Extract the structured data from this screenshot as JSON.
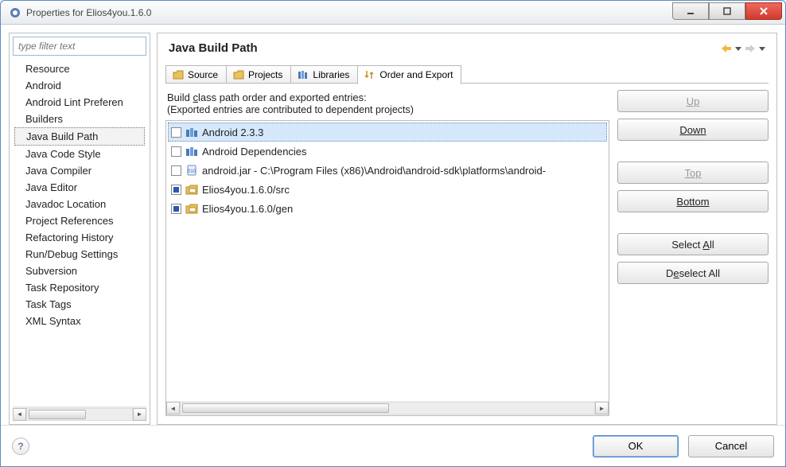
{
  "window": {
    "title": "Properties for Elios4you.1.6.0"
  },
  "sidebar": {
    "filter_placeholder": "type filter text",
    "items": [
      {
        "label": "Resource"
      },
      {
        "label": "Android"
      },
      {
        "label": "Android Lint Preferen"
      },
      {
        "label": "Builders"
      },
      {
        "label": "Java Build Path",
        "selected": true
      },
      {
        "label": "Java Code Style"
      },
      {
        "label": "Java Compiler"
      },
      {
        "label": "Java Editor"
      },
      {
        "label": "Javadoc Location"
      },
      {
        "label": "Project References"
      },
      {
        "label": "Refactoring History"
      },
      {
        "label": "Run/Debug Settings"
      },
      {
        "label": "Subversion"
      },
      {
        "label": "Task Repository"
      },
      {
        "label": "Task Tags"
      },
      {
        "label": "XML Syntax"
      }
    ]
  },
  "main": {
    "heading": "Java Build Path",
    "tabs": [
      {
        "label": "Source",
        "icon": "folder"
      },
      {
        "label": "Projects",
        "icon": "folder"
      },
      {
        "label": "Libraries",
        "icon": "library"
      },
      {
        "label": "Order and Export",
        "icon": "order",
        "active": true
      }
    ],
    "description_line1_pre": "Build ",
    "description_line1_ul": "c",
    "description_line1_post": "lass path order and exported entries:",
    "description_line2": "(Exported entries are contributed to dependent projects)",
    "entries": [
      {
        "checked": false,
        "icon": "lib",
        "label": "Android 2.3.3",
        "selected": true
      },
      {
        "checked": false,
        "icon": "lib",
        "label": "Android Dependencies"
      },
      {
        "checked": false,
        "icon": "jar",
        "label": "android.jar - C:\\Program Files (x86)\\Android\\android-sdk\\platforms\\android-"
      },
      {
        "checked": true,
        "icon": "src",
        "label": "Elios4you.1.6.0/src"
      },
      {
        "checked": true,
        "icon": "src",
        "label": "Elios4you.1.6.0/gen"
      }
    ],
    "buttons": {
      "up": "Up",
      "down": "Down",
      "top": "Top",
      "bottom": "Bottom",
      "selectall_pre": "Select ",
      "selectall_ul": "A",
      "selectall_post": "ll",
      "deselectall_pre": "D",
      "deselectall_ul": "e",
      "deselectall_post": "select All"
    }
  },
  "footer": {
    "ok": "OK",
    "cancel": "Cancel"
  }
}
